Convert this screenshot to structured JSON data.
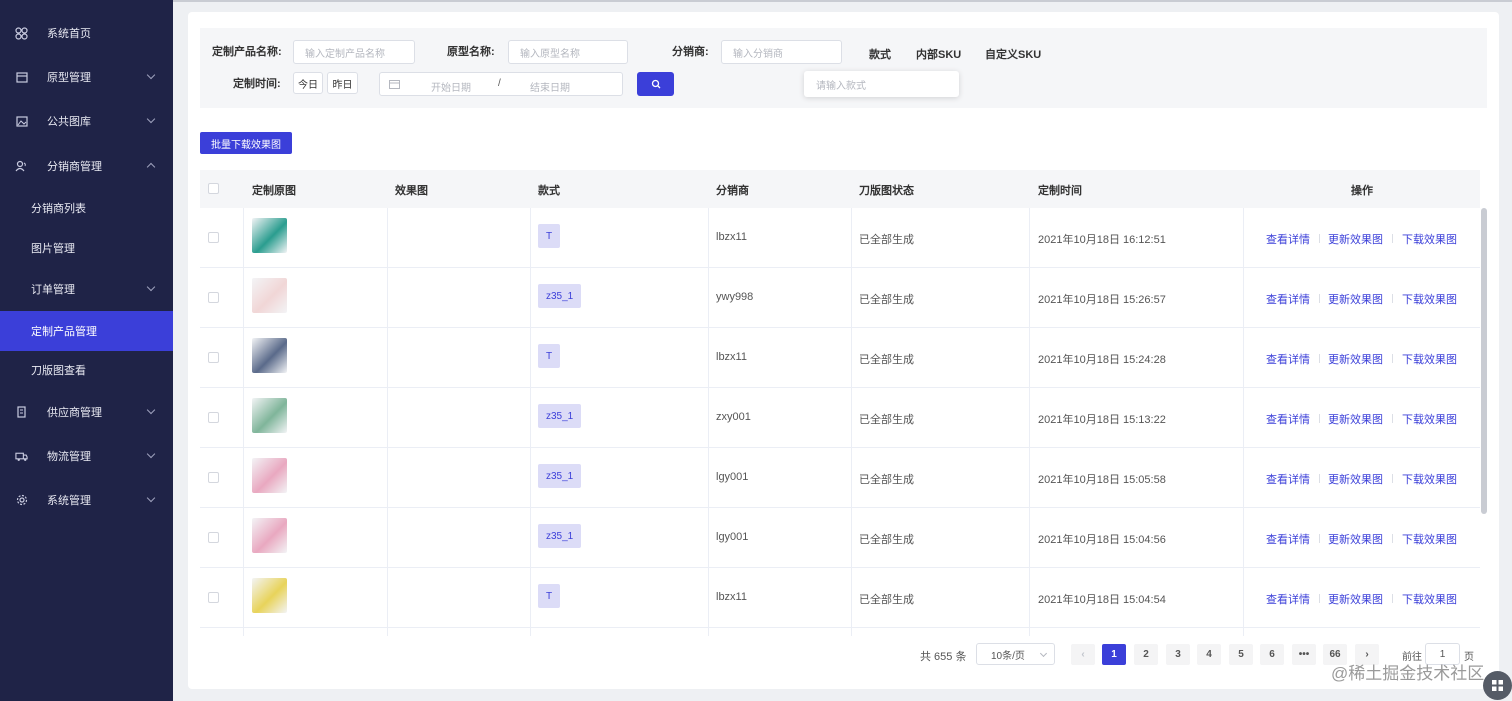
{
  "sidebar": {
    "items": [
      {
        "label": "系统首页",
        "icon": "dashboard-icon"
      },
      {
        "label": "原型管理",
        "icon": "box-icon"
      },
      {
        "label": "公共图库",
        "icon": "image-icon"
      },
      {
        "label": "分销商管理",
        "icon": "users-icon"
      },
      {
        "label": "供应商管理",
        "icon": "building-icon"
      },
      {
        "label": "物流管理",
        "icon": "truck-icon"
      },
      {
        "label": "系统管理",
        "icon": "gear-icon"
      }
    ],
    "subitems": [
      {
        "label": "分销商列表"
      },
      {
        "label": "图片管理"
      },
      {
        "label": "订单管理"
      },
      {
        "label": "定制产品管理",
        "active": true
      },
      {
        "label": "刀版图查看"
      }
    ]
  },
  "filter": {
    "product_name_label": "定制产品名称:",
    "product_name_placeholder": "输入定制产品名称",
    "prototype_label": "原型名称:",
    "prototype_placeholder": "输入原型名称",
    "distributor_label": "分销商:",
    "distributor_placeholder": "输入分销商",
    "tab_style": "款式",
    "tab_internal_sku": "内部SKU",
    "tab_custom_sku": "自定义SKU",
    "style_placeholder": "请输入款式",
    "time_label": "定制时间:",
    "today": "今日",
    "yesterday": "昨日",
    "start_date": "开始日期",
    "date_sep": "/",
    "end_date": "结束日期"
  },
  "batch_download_label": "批量下载效果图",
  "table": {
    "headers": [
      "定制原图",
      "效果图",
      "款式",
      "分销商",
      "刀版图状态",
      "定制时间",
      "操作"
    ],
    "rows": [
      {
        "style": "T",
        "distributor": "lbzx11",
        "status": "已全部生成",
        "time": "2021年10月18日 16:12:51",
        "thumb_color": "#2a9d8f"
      },
      {
        "style": "z35_1",
        "distributor": "ywy998",
        "status": "已全部生成",
        "time": "2021年10月18日 15:26:57",
        "thumb_color": "#f1d6d6"
      },
      {
        "style": "T",
        "distributor": "lbzx11",
        "status": "已全部生成",
        "time": "2021年10月18日 15:24:28",
        "thumb_color": "#5a6a8a"
      },
      {
        "style": "z35_1",
        "distributor": "zxy001",
        "status": "已全部生成",
        "time": "2021年10月18日 15:13:22",
        "thumb_color": "#7fb59a"
      },
      {
        "style": "z35_1",
        "distributor": "lgy001",
        "status": "已全部生成",
        "time": "2021年10月18日 15:05:58",
        "thumb_color": "#e9a8c0"
      },
      {
        "style": "z35_1",
        "distributor": "lgy001",
        "status": "已全部生成",
        "time": "2021年10月18日 15:04:56",
        "thumb_color": "#e9a8c0"
      },
      {
        "style": "T",
        "distributor": "lbzx11",
        "status": "已全部生成",
        "time": "2021年10月18日 15:04:54",
        "thumb_color": "#e8d35a"
      }
    ],
    "actions": [
      "查看详情",
      "更新效果图",
      "下载效果图"
    ]
  },
  "pagination": {
    "total": "共 655 条",
    "page_size": "10条/页",
    "pages": [
      "1",
      "2",
      "3",
      "4",
      "5",
      "6",
      "•••",
      "66"
    ],
    "prev": "‹",
    "next": "›",
    "goto_label": "前往",
    "goto_value": "1",
    "page_suffix": "页"
  },
  "watermark": "@稀土掘金技术社区",
  "colors": {
    "sidebar_bg": "#1f2347",
    "primary": "#3b3fd9"
  }
}
